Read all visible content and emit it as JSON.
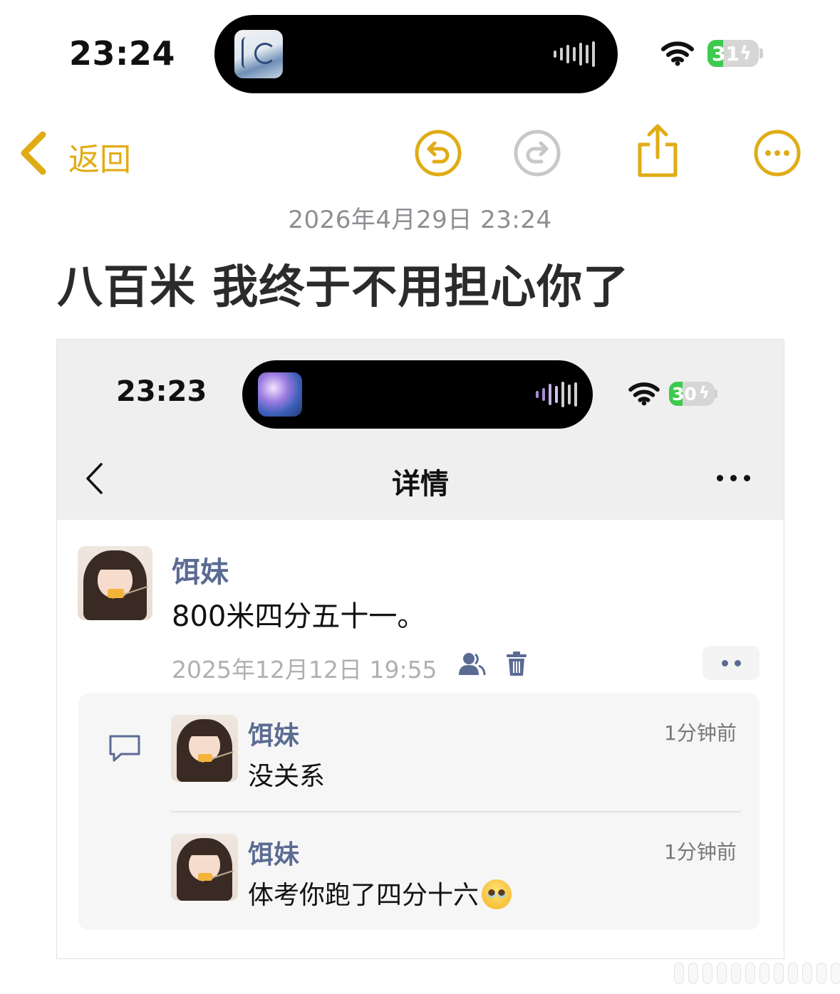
{
  "status_bar": {
    "time": "23:24",
    "battery": "31",
    "battery_level": 0.31
  },
  "toolbar": {
    "back_label": "返回",
    "icons": [
      "undo-icon",
      "redo-icon",
      "share-icon",
      "more-icon"
    ]
  },
  "note": {
    "date": "2026年4月29日 23:24",
    "title": "八百米 我终于不用担心你了"
  },
  "screenshot": {
    "status_bar": {
      "time": "23:23",
      "battery": "30",
      "battery_level": 0.3
    },
    "header": {
      "title": "详情"
    },
    "post": {
      "author": "饵妹",
      "text": "800米四分五十一。",
      "time": "2025年12月12日 19:55"
    },
    "comments": [
      {
        "author": "饵妹",
        "time": "1分钟前",
        "text": "没关系"
      },
      {
        "author": "饵妹",
        "time": "1分钟前",
        "text": "体考你跑了四分十六",
        "emoji": "pleading-face"
      }
    ]
  },
  "colors": {
    "accent": "#e0ac16",
    "name_blue": "#5b6b92",
    "battery_green": "#3ec94f",
    "muted": "#8e8e93"
  }
}
